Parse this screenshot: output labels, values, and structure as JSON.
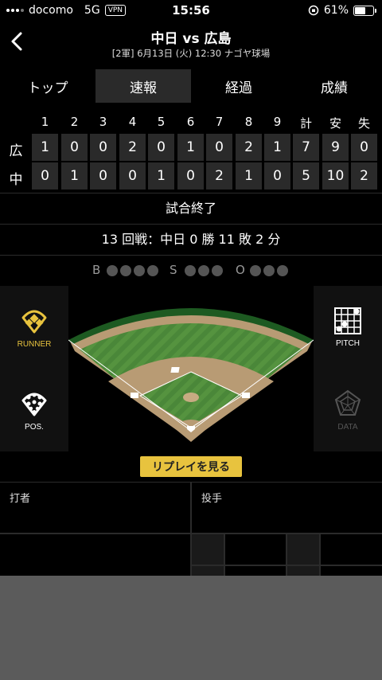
{
  "status_bar": {
    "carrier": "docomo",
    "network": "5G",
    "vpn": "VPN",
    "time": "15:56",
    "battery": "61%",
    "battery_level": 0.61
  },
  "header": {
    "title": "中日 vs 広島",
    "subtitle": "[2軍] 6月13日 (火) 12:30 ナゴヤ球場"
  },
  "tabs": [
    {
      "label": "トップ",
      "active": false
    },
    {
      "label": "速報",
      "active": true
    },
    {
      "label": "経過",
      "active": false
    },
    {
      "label": "成績",
      "active": false
    }
  ],
  "scoreboard": {
    "columns": [
      "1",
      "2",
      "3",
      "4",
      "5",
      "6",
      "7",
      "8",
      "9",
      "計",
      "安",
      "失"
    ],
    "rows": [
      {
        "team": "広",
        "values": [
          "1",
          "0",
          "0",
          "2",
          "0",
          "1",
          "0",
          "2",
          "1",
          "7",
          "9",
          "0"
        ]
      },
      {
        "team": "中",
        "values": [
          "0",
          "1",
          "0",
          "0",
          "1",
          "0",
          "2",
          "1",
          "0",
          "5",
          "10",
          "2"
        ]
      }
    ]
  },
  "game_status": "試合終了",
  "series_record": "13 回戦：中日 0 勝 11 敗 2 分",
  "count": {
    "b_label": "B",
    "s_label": "S",
    "o_label": "O",
    "balls": 0,
    "strikes": 0,
    "outs": 0
  },
  "side_buttons": {
    "runner": "RUNNER",
    "pitch": "PITCH",
    "pos": "POS.",
    "data": "DATA"
  },
  "replay_label": "リプレイを見る",
  "panels": {
    "batter": "打者",
    "pitcher": "投手"
  },
  "colors": {
    "accent": "#e8c33e",
    "field_grass": "#4e8a3c",
    "infield_dirt": "#b89b74",
    "outfield_wall": "#1f5c22"
  }
}
